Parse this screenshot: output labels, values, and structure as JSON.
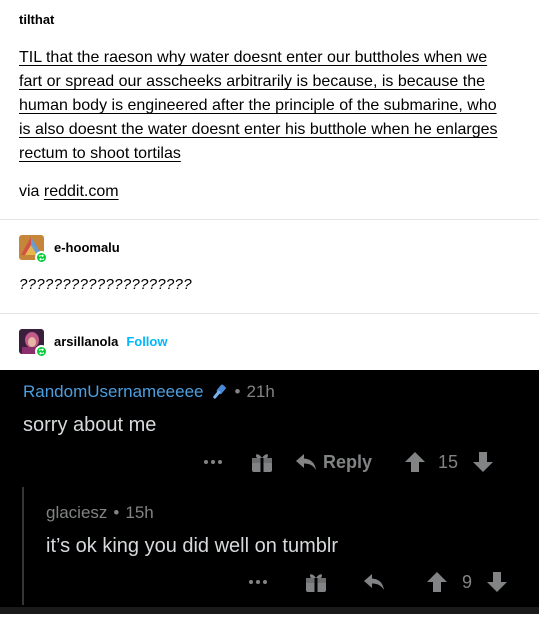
{
  "post": {
    "blog_name": "tilthat",
    "body_lines": [
      "TIL that the raeson why water doesnt enter our buttholes when we",
      "fart or spread our asscheeks arbitrarily is because, is because the",
      "human body is engineered after the principle of the submarine, who",
      "is also doesnt the water doesnt enter his butthole when he enlarges",
      "rectum to shoot tortilas"
    ],
    "via_prefix": "via",
    "via_link": "reddit.com"
  },
  "reblogs": [
    {
      "username": "e-hoomalu",
      "text": "????????????????????"
    },
    {
      "username": "arsillanola",
      "follow_label": "Follow"
    }
  ],
  "screenshot": {
    "comment1": {
      "user": "RandomUsernameeeee",
      "flair_icon": "tool-icon",
      "separator": "•",
      "time": "21h",
      "body": "sorry about me",
      "reply_label": "Reply",
      "votes": "15"
    },
    "comment2": {
      "user": "glaciesz",
      "separator": "•",
      "time": "15h",
      "body": "it’s ok king you did well on tumblr",
      "votes": "9"
    }
  },
  "colors": {
    "follow": "#00b8ff",
    "reblog_badge": "#00cf35",
    "reddit_user": "#4d9ee0",
    "reddit_meta": "#818384",
    "reddit_text": "#d7dadc"
  }
}
